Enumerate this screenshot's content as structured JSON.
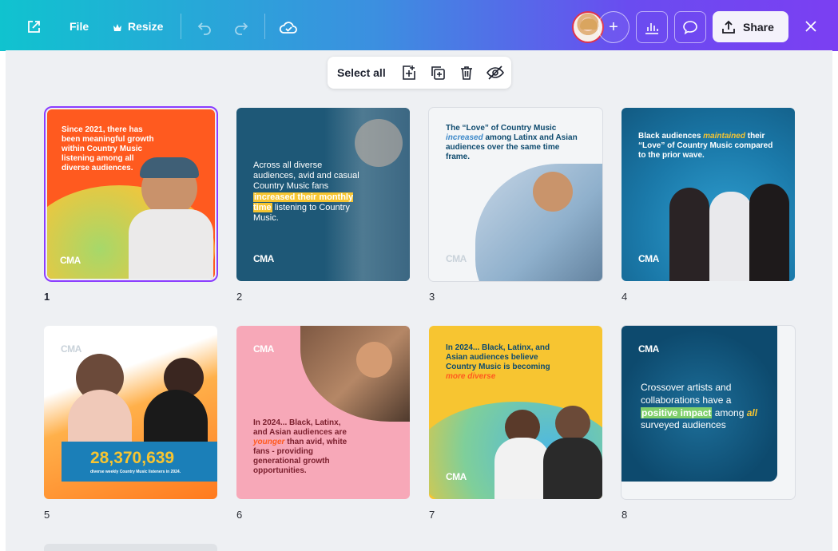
{
  "header": {
    "file_label": "File",
    "resize_label": "Resize",
    "share_label": "Share"
  },
  "toolbar": {
    "select_all_label": "Select all"
  },
  "pages": [
    {
      "number": "1",
      "text": "Since 2021, there has been meaningful growth within Country Music listening among all diverse audiences.",
      "logo": "CMA"
    },
    {
      "number": "2",
      "text_before": "Across all diverse audiences, avid and casual Country Music fans",
      "highlight": "increased their monthly time",
      "text_after": "listening to Country Music.",
      "logo": "CMA"
    },
    {
      "number": "3",
      "text_before": "The “Love” of Country Music",
      "highlight": "increased",
      "text_after": "among Latinx and Asian audiences over the same time frame.",
      "logo": "CMA"
    },
    {
      "number": "4",
      "text_before": "Black audiences",
      "highlight": "maintained",
      "text_after": "their “Love” of Country Music compared to the prior wave.",
      "logo": "CMA"
    },
    {
      "number": "5",
      "stat": "28,370,639",
      "stat_caption": "diverse weekly Country Music listeners in 2024.",
      "logo": "CMA"
    },
    {
      "number": "6",
      "text_before": "In 2024... Black, Latinx, and Asian audiences are",
      "highlight": "younger",
      "text_after": "than avid, white fans - providing generational growth opportunities.",
      "logo": "CMA"
    },
    {
      "number": "7",
      "text_before": "In 2024... Black, Latinx, and Asian audiences believe Country Music is becoming",
      "highlight": "more diverse",
      "logo": "CMA"
    },
    {
      "number": "8",
      "text_before": "Crossover artists and collaborations have a",
      "highlight": "positive impact",
      "text_mid": "among",
      "highlight2": "all",
      "text_after": "surveyed audiences",
      "logo": "CMA"
    }
  ],
  "colors": {
    "selection_outline": "#8b3dff",
    "workspace_bg": "#eef0f3",
    "cma_orange": "#ff5a1f",
    "cma_navy": "#0d4a6e",
    "cma_yellow": "#f7c531",
    "cma_pink": "#f7a8b8"
  }
}
